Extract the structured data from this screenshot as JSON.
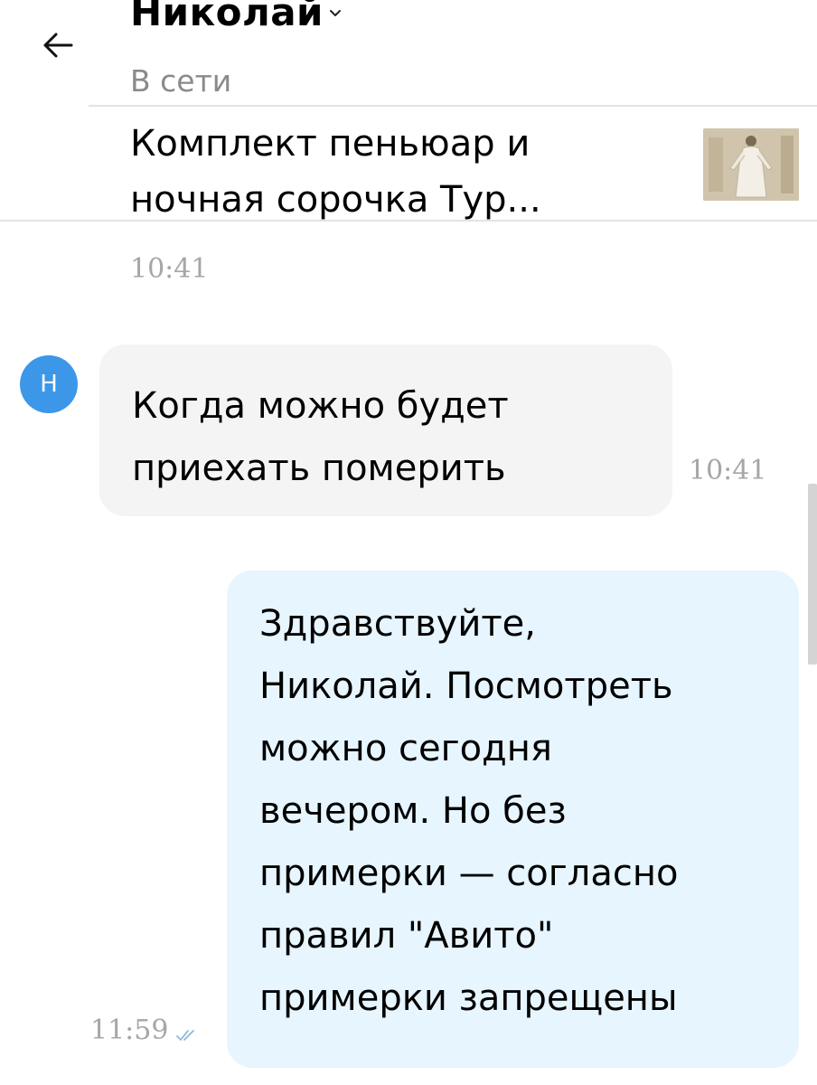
{
  "header": {
    "contact_name": "Николай",
    "status": "В сети"
  },
  "listing": {
    "title": "Комплект пеньюар и ночная сорочка Тур...",
    "time": "10:41"
  },
  "messages": [
    {
      "direction": "incoming",
      "avatar_letter": "Н",
      "text": "Когда можно будет приехать померить",
      "time": "10:41"
    },
    {
      "direction": "outgoing",
      "text": "Здравствуйте,\nНиколай. Посмотреть\nможно сегодня\nвечером. Но без\nпримерки — согласно\nправил \"Авито\"\nпримерки запрещены",
      "time": "11:59",
      "status_icon": "double-check-icon"
    }
  ],
  "colors": {
    "avatar": "#3d97e9",
    "incoming_bubble": "#f4f4f4",
    "outgoing_bubble": "#e7f5fe",
    "muted_text": "#8a8a8a",
    "time_text": "#a6a6a6",
    "read_check": "#8fb8dc"
  }
}
